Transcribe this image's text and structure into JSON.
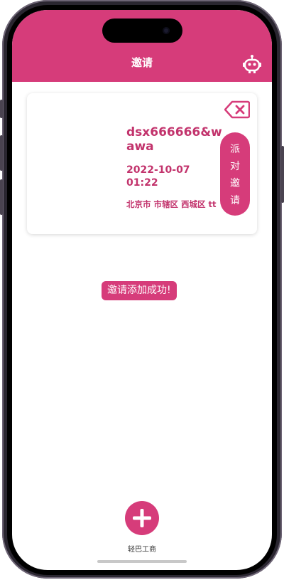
{
  "header": {
    "title": "邀请",
    "icon": "robot-icon"
  },
  "invite_card": {
    "name": "dsx666666&wawa",
    "datetime": "2022-10-07 01:22",
    "address": "北京市 市辖区 西城区 tt",
    "delete_icon": "backspace-delete-icon",
    "party_button_chars": [
      "派",
      "对",
      "邀",
      "请"
    ]
  },
  "toast": {
    "message": "邀请添加成功!"
  },
  "fab": {
    "icon": "plus-icon"
  },
  "watermark": {
    "text": "轻巴工商"
  },
  "colors": {
    "brand": "#d63c7a",
    "text_accent": "#c2336c"
  }
}
